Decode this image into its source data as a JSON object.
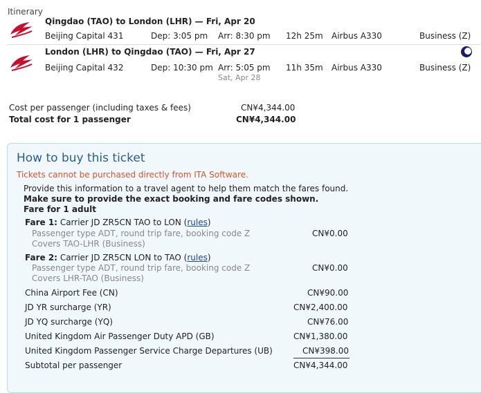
{
  "itinerary": {
    "heading": "Itinerary",
    "flights": [
      {
        "route": "Qingdao (TAO) to London (LHR) — Fri, Apr 20",
        "airline": "Beijing Capital 431",
        "dep": "Dep: 3:05 pm",
        "arr": "Arr: 8:30 pm",
        "arr_date": "",
        "duration": "12h 25m",
        "aircraft": "Airbus A330",
        "cabin": "Business (Z)"
      },
      {
        "route": "London (LHR) to Qingdao (TAO) — Fri, Apr 27",
        "airline": "Beijing Capital 432",
        "dep": "Dep: 10:30 pm",
        "arr": "Arr: 5:05 pm",
        "arr_date": "Sat, Apr 28",
        "duration": "11h 35m",
        "aircraft": "Airbus A330",
        "cabin": "Business (Z)"
      }
    ]
  },
  "cost": {
    "per_passenger_label": "Cost per passenger (including taxes & fees)",
    "per_passenger_value": "CN¥4,344.00",
    "total_label": "Total cost for 1 passenger",
    "total_value": "CN¥4,344.00"
  },
  "buy": {
    "title": "How to buy this ticket",
    "warning": "Tickets cannot be purchased directly from ITA Software.",
    "info": "Provide this information to a travel agent to help them match the fares found.",
    "emphasis": "Make sure to provide the exact booking and fare codes shown.",
    "fare_header": "Fare for 1 adult",
    "fares": [
      {
        "label": "Fare 1:",
        "desc": "Carrier JD ZR5CN TAO to LON",
        "rules_open": "(",
        "rules": "rules",
        "rules_close": ")",
        "detail1": "Passenger type ADT, round trip fare, booking code Z",
        "detail2": "Covers TAO-LHR (Business)",
        "amount": "CN¥0.00"
      },
      {
        "label": "Fare 2:",
        "desc": "Carrier JD ZR5CN LON to TAO",
        "rules_open": "(",
        "rules": "rules",
        "rules_close": ")",
        "detail1": "Passenger type ADT, round trip fare, booking code Z",
        "detail2": "Covers LHR-TAO (Business)",
        "amount": "CN¥0.00"
      }
    ],
    "taxes": [
      {
        "label": "China Airport Fee (CN)",
        "amount": "CN¥90.00"
      },
      {
        "label": "JD YR surcharge (YR)",
        "amount": "CN¥2,400.00"
      },
      {
        "label": "JD YQ surcharge (YQ)",
        "amount": "CN¥76.00"
      },
      {
        "label": "United Kingdom Air Passenger Duty APD (GB)",
        "amount": "CN¥1,380.00"
      },
      {
        "label": "United Kingdom Passenger Service Charge Departures (UB)",
        "amount": "CN¥398.00"
      }
    ],
    "subtotal_label": "Subtotal per passenger",
    "subtotal_value": "CN¥4,344.00"
  },
  "colors": {
    "warning": "#d9532c",
    "title": "#2a5d8c",
    "link": "#1a44a8",
    "logo": "#c8102e"
  },
  "icons": [
    "beijing-capital-airlines-logo",
    "overnight-moon-icon"
  ]
}
